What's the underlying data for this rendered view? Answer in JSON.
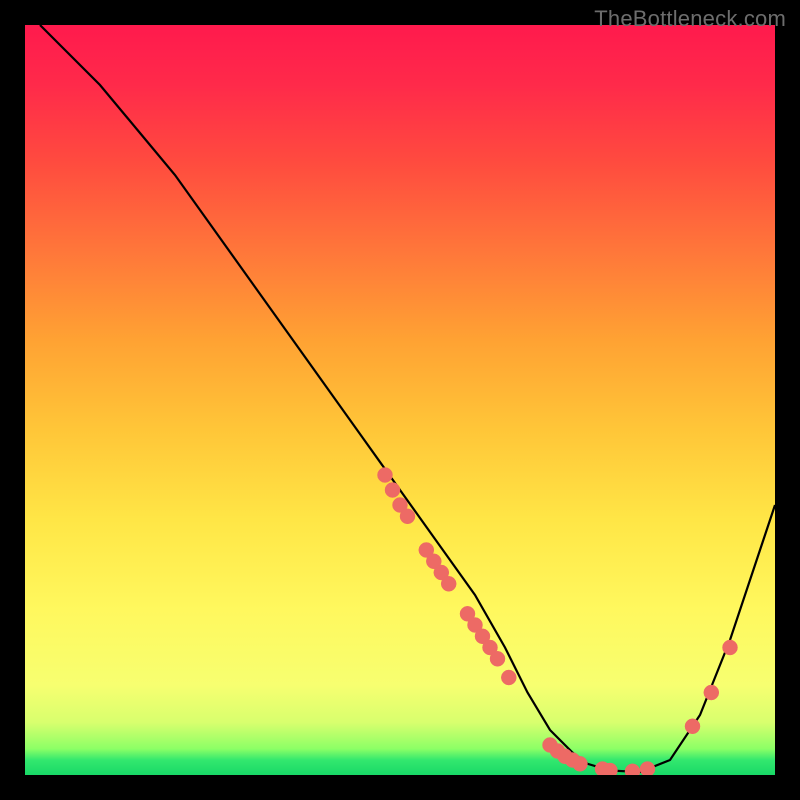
{
  "attribution": "TheBottleneck.com",
  "chart_data": {
    "type": "line",
    "title": "",
    "xlabel": "",
    "ylabel": "",
    "xlim": [
      0,
      100
    ],
    "ylim": [
      0,
      100
    ],
    "grid": false,
    "legend": false,
    "series": [
      {
        "name": "bottleneck-curve",
        "x": [
          2,
          5,
          10,
          15,
          20,
          25,
          30,
          35,
          40,
          45,
          50,
          55,
          60,
          64,
          67,
          70,
          73,
          75,
          78,
          82,
          86,
          90,
          94,
          98,
          100
        ],
        "y": [
          100,
          97,
          92,
          86,
          80,
          73,
          66,
          59,
          52,
          45,
          38,
          31,
          24,
          17,
          11,
          6,
          3,
          1.5,
          0.6,
          0.4,
          2,
          8,
          18,
          30,
          36
        ]
      }
    ],
    "markers": [
      {
        "name": "scatter-left-cluster",
        "points": [
          {
            "x": 48,
            "y": 40
          },
          {
            "x": 49,
            "y": 38
          },
          {
            "x": 50,
            "y": 36
          },
          {
            "x": 51,
            "y": 34.5
          },
          {
            "x": 53.5,
            "y": 30
          },
          {
            "x": 54.5,
            "y": 28.5
          },
          {
            "x": 55.5,
            "y": 27
          },
          {
            "x": 56.5,
            "y": 25.5
          },
          {
            "x": 59,
            "y": 21.5
          },
          {
            "x": 60,
            "y": 20
          },
          {
            "x": 61,
            "y": 18.5
          },
          {
            "x": 62,
            "y": 17
          },
          {
            "x": 63,
            "y": 15.5
          },
          {
            "x": 64.5,
            "y": 13
          }
        ]
      },
      {
        "name": "scatter-minimum-cluster",
        "points": [
          {
            "x": 70,
            "y": 4
          },
          {
            "x": 71,
            "y": 3.2
          },
          {
            "x": 72,
            "y": 2.5
          },
          {
            "x": 73,
            "y": 2
          },
          {
            "x": 74,
            "y": 1.5
          },
          {
            "x": 77,
            "y": 0.8
          },
          {
            "x": 78,
            "y": 0.6
          },
          {
            "x": 81,
            "y": 0.5
          },
          {
            "x": 83,
            "y": 0.8
          }
        ]
      },
      {
        "name": "scatter-right-cluster",
        "points": [
          {
            "x": 89,
            "y": 6.5
          },
          {
            "x": 91.5,
            "y": 11
          },
          {
            "x": 94,
            "y": 17
          }
        ]
      }
    ],
    "background": {
      "type": "vertical-gradient",
      "stops": [
        {
          "pos": 0.0,
          "color": "#ff1a4d"
        },
        {
          "pos": 0.3,
          "color": "#ff763a"
        },
        {
          "pos": 0.66,
          "color": "#ffe646"
        },
        {
          "pos": 0.93,
          "color": "#d8ff6e"
        },
        {
          "pos": 1.0,
          "color": "#18d967"
        }
      ]
    },
    "marker_color": "#ed6a65",
    "curve_color": "#000000"
  }
}
